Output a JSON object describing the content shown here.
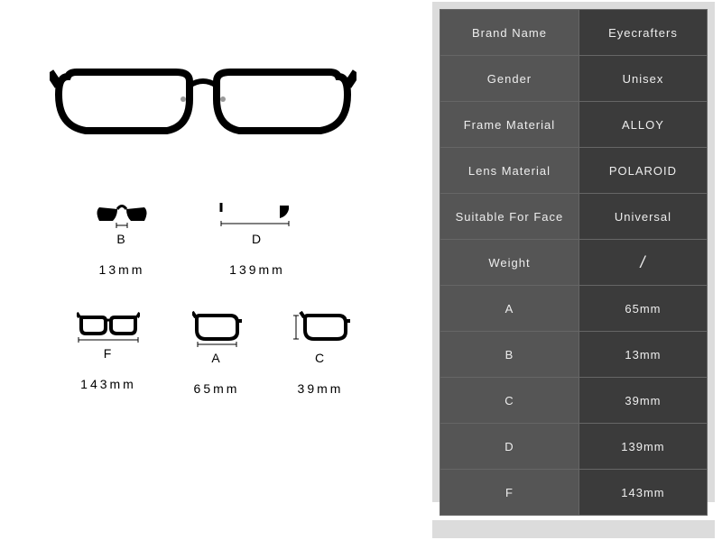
{
  "measurements": {
    "B": {
      "letter": "B",
      "value": "13mm"
    },
    "D": {
      "letter": "D",
      "value": "139mm"
    },
    "F": {
      "letter": "F",
      "value": "143mm"
    },
    "A": {
      "letter": "A",
      "value": "65mm"
    },
    "C": {
      "letter": "C",
      "value": "39mm"
    }
  },
  "specs": {
    "brand_name": {
      "label": "Brand Name",
      "value": "Eyecrafters"
    },
    "gender": {
      "label": "Gender",
      "value": "Unisex"
    },
    "frame_mat": {
      "label": "Frame Material",
      "value": "ALLOY"
    },
    "lens_mat": {
      "label": "Lens Material",
      "value": "POLAROID"
    },
    "face": {
      "label": "Suitable For Face",
      "value": "Universal"
    },
    "weight": {
      "label": "Weight",
      "value": "/"
    },
    "a": {
      "label": "A",
      "value": "65mm"
    },
    "b": {
      "label": "B",
      "value": "13mm"
    },
    "c": {
      "label": "C",
      "value": "39mm"
    },
    "d": {
      "label": "D",
      "value": "139mm"
    },
    "f": {
      "label": "F",
      "value": "143mm"
    }
  }
}
